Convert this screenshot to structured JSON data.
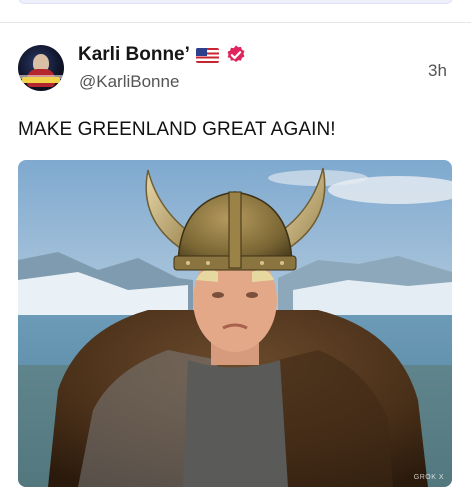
{
  "post": {
    "author_name": "Karli Bonne’",
    "handle": "@KarliBonne",
    "timestamp": "3h",
    "text": "MAKE GREENLAND GREAT AGAIN!",
    "verified": true,
    "flag_icon": "us-flag-icon",
    "verified_icon": "verified-badge-icon",
    "image_watermark": "GROK X",
    "colors": {
      "verified": "#e0245e",
      "name": "#161616",
      "meta": "#555555"
    }
  }
}
